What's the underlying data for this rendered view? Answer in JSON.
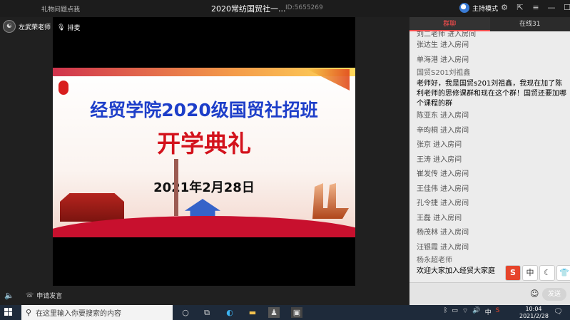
{
  "titlebar": {
    "gift_link": "礼物问题点我",
    "title": "2020常纺国贸社一...",
    "room_id": "ID:5655269",
    "host_mode": "主持模式"
  },
  "sidebar": {
    "teacher": "左武荣老师"
  },
  "video": {
    "mic_label": "排麦",
    "slide": {
      "title": "经贸学院2020级国贸社招班",
      "subtitle": "开学典礼",
      "date": "2021年2月28日"
    }
  },
  "bottom": {
    "apply_label": "申请发言"
  },
  "chat": {
    "tabs": [
      "群聊",
      "在线31"
    ],
    "messages": [
      {
        "type": "cut",
        "text": "刘二老师  进入房间"
      },
      {
        "type": "line",
        "text": "张达生  进入房间"
      },
      {
        "type": "line",
        "text": "单海港  进入房间"
      },
      {
        "type": "sender",
        "text": "国贸S201刘祖鑫"
      },
      {
        "type": "body",
        "text": "老师好，我是国贸s201刘祖鑫，我现在加了陈利老师的思修课群和现在这个群！国贸还要加哪个课程的群"
      },
      {
        "type": "line",
        "text": "陈亚东  进入房间"
      },
      {
        "type": "line",
        "text": "辛昀桐  进入房间"
      },
      {
        "type": "line",
        "text": "张京  进入房间"
      },
      {
        "type": "line",
        "text": "王涛  进入房间"
      },
      {
        "type": "line",
        "text": "崔发传  进入房间"
      },
      {
        "type": "line",
        "text": "王佳伟  进入房间"
      },
      {
        "type": "line",
        "text": "孔令捷  进入房间"
      },
      {
        "type": "line",
        "text": "王磊  进入房间"
      },
      {
        "type": "line",
        "text": "杨茂林  进入房间"
      },
      {
        "type": "line",
        "text": "汪银霞  进入房间"
      },
      {
        "type": "sender",
        "text": "杨永超老师"
      },
      {
        "type": "body",
        "text": "欢迎大家加入经贸大家庭"
      }
    ],
    "input_placeholder": "",
    "send_label": "发送"
  },
  "ime": [
    "S",
    "中",
    "☾",
    "👕"
  ],
  "taskbar": {
    "search_placeholder": "在这里输入你要搜索的内容",
    "lang": "中",
    "time": "10:04",
    "date": "2021/2/28"
  },
  "colors": {
    "accent": "#ff4d4d",
    "slide_title": "#1d3ec9",
    "slide_subtitle": "#d3121c"
  }
}
